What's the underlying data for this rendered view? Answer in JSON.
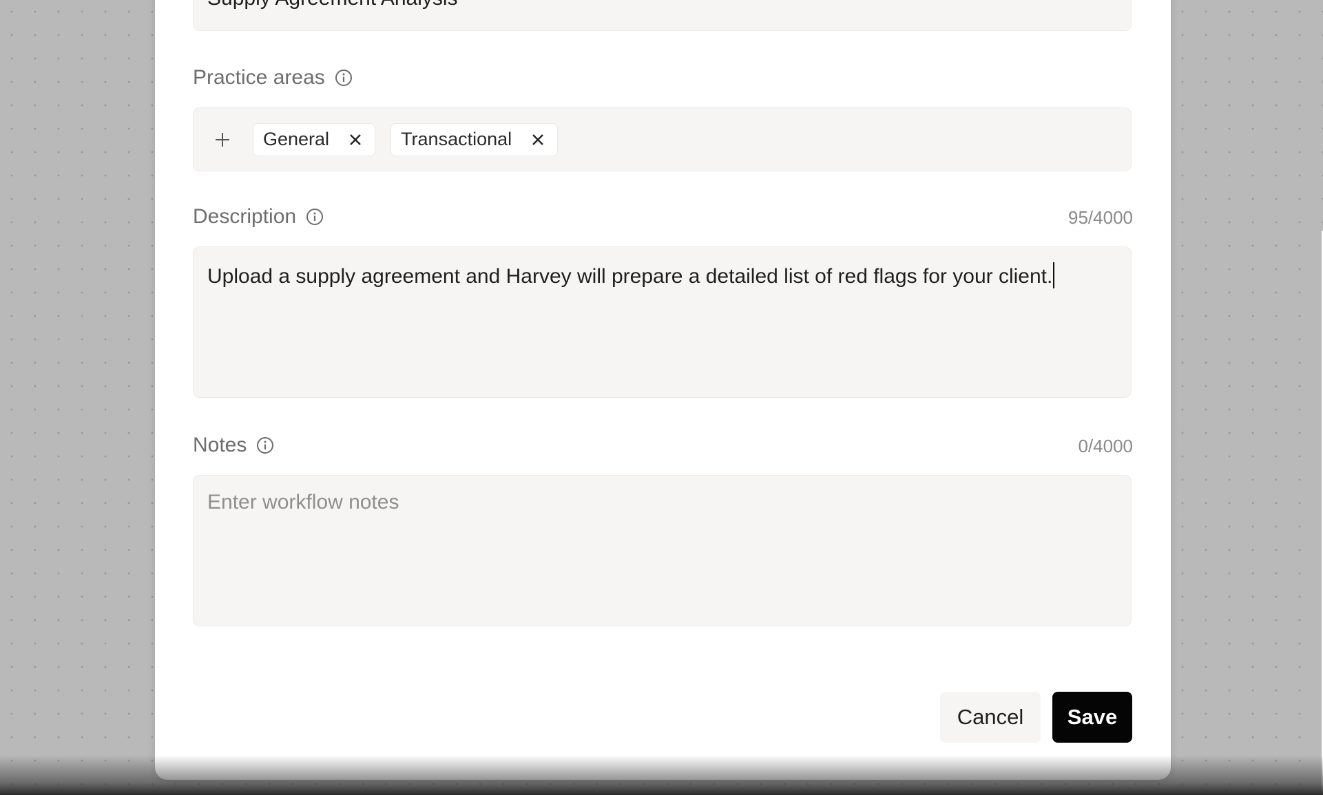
{
  "workflow_name": {
    "value": "Supply Agreement Analysis"
  },
  "practice_areas": {
    "label": "Practice areas",
    "tags": [
      {
        "label": "General"
      },
      {
        "label": "Transactional"
      }
    ]
  },
  "description": {
    "label": "Description",
    "counter": "95/4000",
    "value": "Upload a supply agreement and Harvey will prepare a detailed list of red flags for your client."
  },
  "notes": {
    "label": "Notes",
    "counter": "0/4000",
    "value": "",
    "placeholder": "Enter workflow notes"
  },
  "buttons": {
    "cancel_label": "Cancel",
    "save_label": "Save"
  },
  "colors": {
    "save_button_bg": "#050505",
    "field_bg": "#f6f5f4",
    "label_text": "#6d6d6d"
  },
  "icons": {
    "info": "info-circle-icon",
    "add": "plus-icon",
    "remove": "close-icon"
  }
}
